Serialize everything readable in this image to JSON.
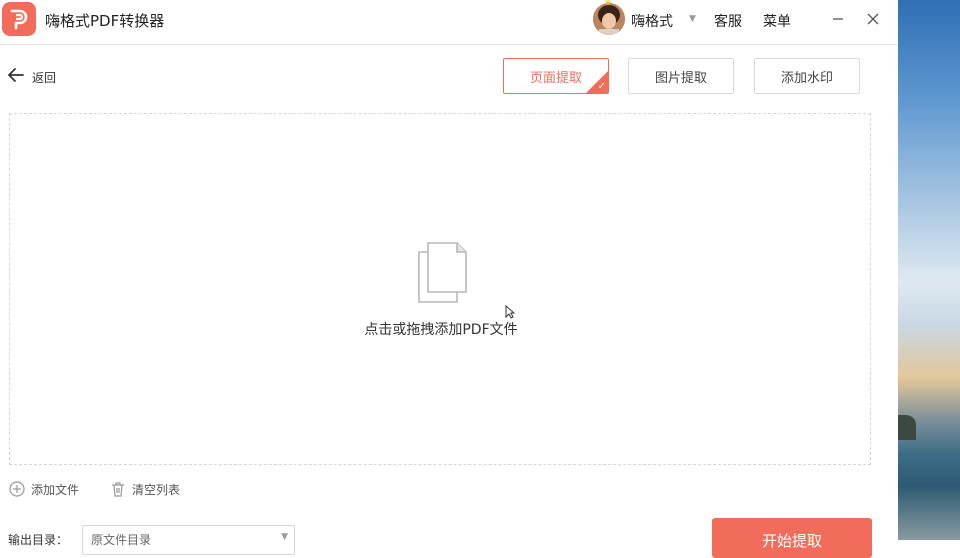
{
  "app": {
    "title": "嗨格式PDF转换器",
    "accent": "#f26c5b"
  },
  "header": {
    "username": "嗨格式",
    "service": "客服",
    "menu": "菜单",
    "minimize_icon": "minimize-icon",
    "close_icon": "close-icon"
  },
  "nav": {
    "back_label": "返回"
  },
  "tabs": [
    {
      "label": "页面提取",
      "active": true
    },
    {
      "label": "图片提取",
      "active": false
    },
    {
      "label": "添加水印",
      "active": false
    }
  ],
  "dropzone": {
    "hint": "点击或拖拽添加PDF文件"
  },
  "actions": {
    "add_file": "添加文件",
    "clear_list": "清空列表"
  },
  "output": {
    "label": "输出目录：",
    "selected": "原文件目录"
  },
  "start_button": "开始提取"
}
